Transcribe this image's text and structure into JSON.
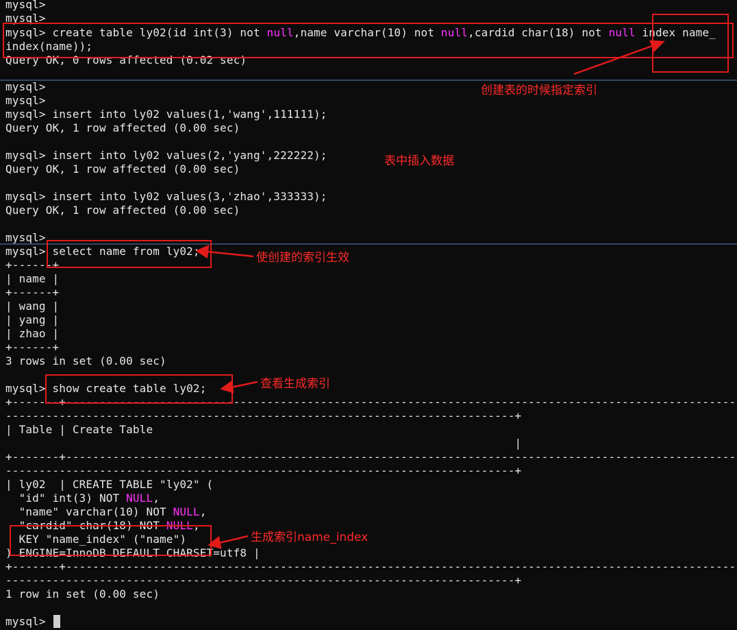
{
  "terminal": {
    "l1": "mysql>",
    "l2": "mysql>",
    "l3a": "mysql> create table ly02(id int(3) not ",
    "l3_null1": "null",
    "l3b": ",name varchar(10) not ",
    "l3_null2": "null",
    "l3c": ",cardid char(18) not ",
    "l3_null3": "null",
    "l3d": " index name_",
    "l4": "index(name));",
    "l5": "Query OK, 0 rows affected (0.02 sec)",
    "l6": "mysql>",
    "l7": "mysql>",
    "l8": "mysql> insert into ly02 values(1,'wang',111111);",
    "l9": "Query OK, 1 row affected (0.00 sec)",
    "l10": "mysql> insert into ly02 values(2,'yang',222222);",
    "l11": "Query OK, 1 row affected (0.00 sec)",
    "l12": "mysql> insert into ly02 values(3,'zhao',333333);",
    "l13": "Query OK, 1 row affected (0.00 sec)",
    "l14": "mysql>",
    "l15": "mysql> select name from ly02;",
    "l16": "+------+",
    "l17": "| name |",
    "l18": "+------+",
    "l19": "| wang |",
    "l20": "| yang |",
    "l21": "| zhao |",
    "l22": "+------+",
    "l23": "3 rows in set (0.00 sec)",
    "l24": "mysql> show create table ly02;",
    "l25": "+-------+---------------------------------------------------------------------------------------------------------",
    "l26": "----------------------------------------------------------------------------+",
    "l27": "| Table | Create Table",
    "l28": "                                                                            |",
    "l29": "+-------+---------------------------------------------------------------------------------------------------------",
    "l30": "----------------------------------------------------------------------------+",
    "l31": "| ly02  | CREATE TABLE \"ly02\" (",
    "l32a": "  \"id\" int(3) NOT ",
    "l32_null": "NULL",
    "l32b": ",",
    "l33a": "  \"name\" varchar(10) NOT ",
    "l33_null": "NULL",
    "l33b": ",",
    "l34a": "  \"cardid\" char(18) NOT ",
    "l34_null": "NULL",
    "l34b": ",",
    "l35": "  KEY \"name_index\" (\"name\")",
    "l36": ") ENGINE=InnoDB DEFAULT CHARSET=utf8 |",
    "l37": "+-------+---------------------------------------------------------------------------------------------------------",
    "l38": "----------------------------------------------------------------------------+",
    "l39": "1 row in set (0.00 sec)",
    "l40": "mysql> "
  },
  "annotations": {
    "create_index": "创建表的时候指定索引",
    "insert_data": "表中插入数据",
    "activate_index": "使创建的索引生效",
    "view_index": "查看生成索引",
    "generated_index": "生成索引name_index"
  },
  "colors": {
    "background": "#0c0c0c",
    "text": "#e8e8e8",
    "keyword_null": "#ff33ff",
    "annotation_red": "#e21b1b",
    "separator": "#2e4a66"
  }
}
